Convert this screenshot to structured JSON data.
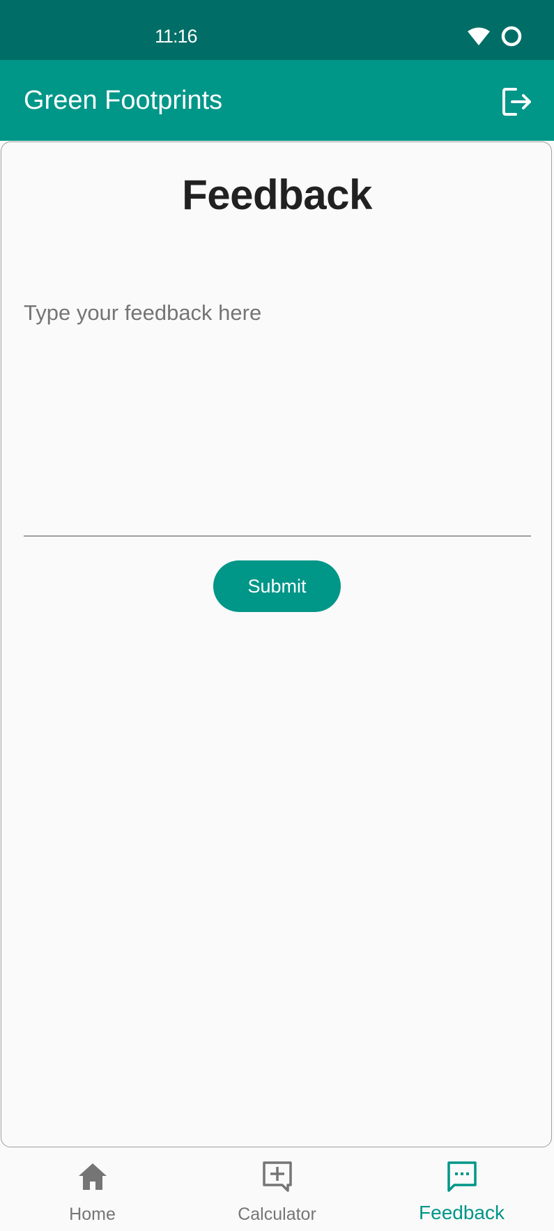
{
  "status_bar": {
    "time": "11:16",
    "wifi_icon": "wifi-icon",
    "battery_icon": "battery-ring-icon"
  },
  "app_bar": {
    "title": "Green Footprints",
    "logout_icon": "logout-icon"
  },
  "page": {
    "title": "Feedback"
  },
  "form": {
    "feedback_placeholder": "Type your feedback here",
    "feedback_value": "",
    "submit_label": "Submit"
  },
  "bottom_nav": {
    "items": [
      {
        "label": "Home",
        "icon": "home-icon",
        "active": false
      },
      {
        "label": "Calculator",
        "icon": "calculator-plus-icon",
        "active": false
      },
      {
        "label": "Feedback",
        "icon": "feedback-chat-icon",
        "active": true
      }
    ]
  },
  "colors": {
    "status_bar": "#006e66",
    "app_bar": "#009688",
    "accent": "#009688",
    "inactive": "#757575",
    "title_text": "#212121"
  }
}
